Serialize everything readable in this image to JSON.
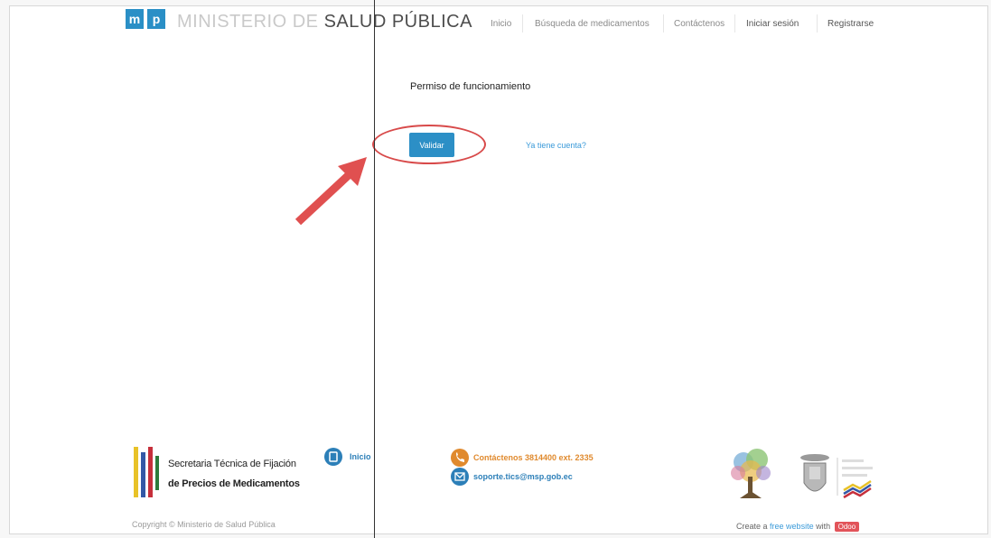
{
  "header": {
    "logo_left": "m",
    "logo_right": "p",
    "brand_light": "MINISTERIO DE ",
    "brand_dark": "SALUD PÚBLICA",
    "nav": [
      "Inicio",
      "Búsqueda de medicamentos",
      "Contáctenos",
      "Iniciar sesión",
      "Registrarse"
    ]
  },
  "main": {
    "title": "Permiso de funcionamiento",
    "validate_button": "Validar",
    "account_link": "Ya tiene cuenta?"
  },
  "footer": {
    "org_line1": "Secretaria Técnica de Fijación",
    "org_line2": "de Precios de Medicamentos",
    "inicio_link": "Inicio",
    "phone": "Contáctenos 3814400 ext. 2335",
    "email": "soporte.tics@msp.gob.ec",
    "copyright": "Copyright © Ministerio de Salud Pública",
    "credit_prefix": "Create a",
    "credit_link": "free website",
    "credit_with": "with",
    "credit_badge": "Odoo"
  },
  "colors": {
    "brand_blue": "#2a8fc6",
    "highlight_red": "#d84a4a"
  }
}
